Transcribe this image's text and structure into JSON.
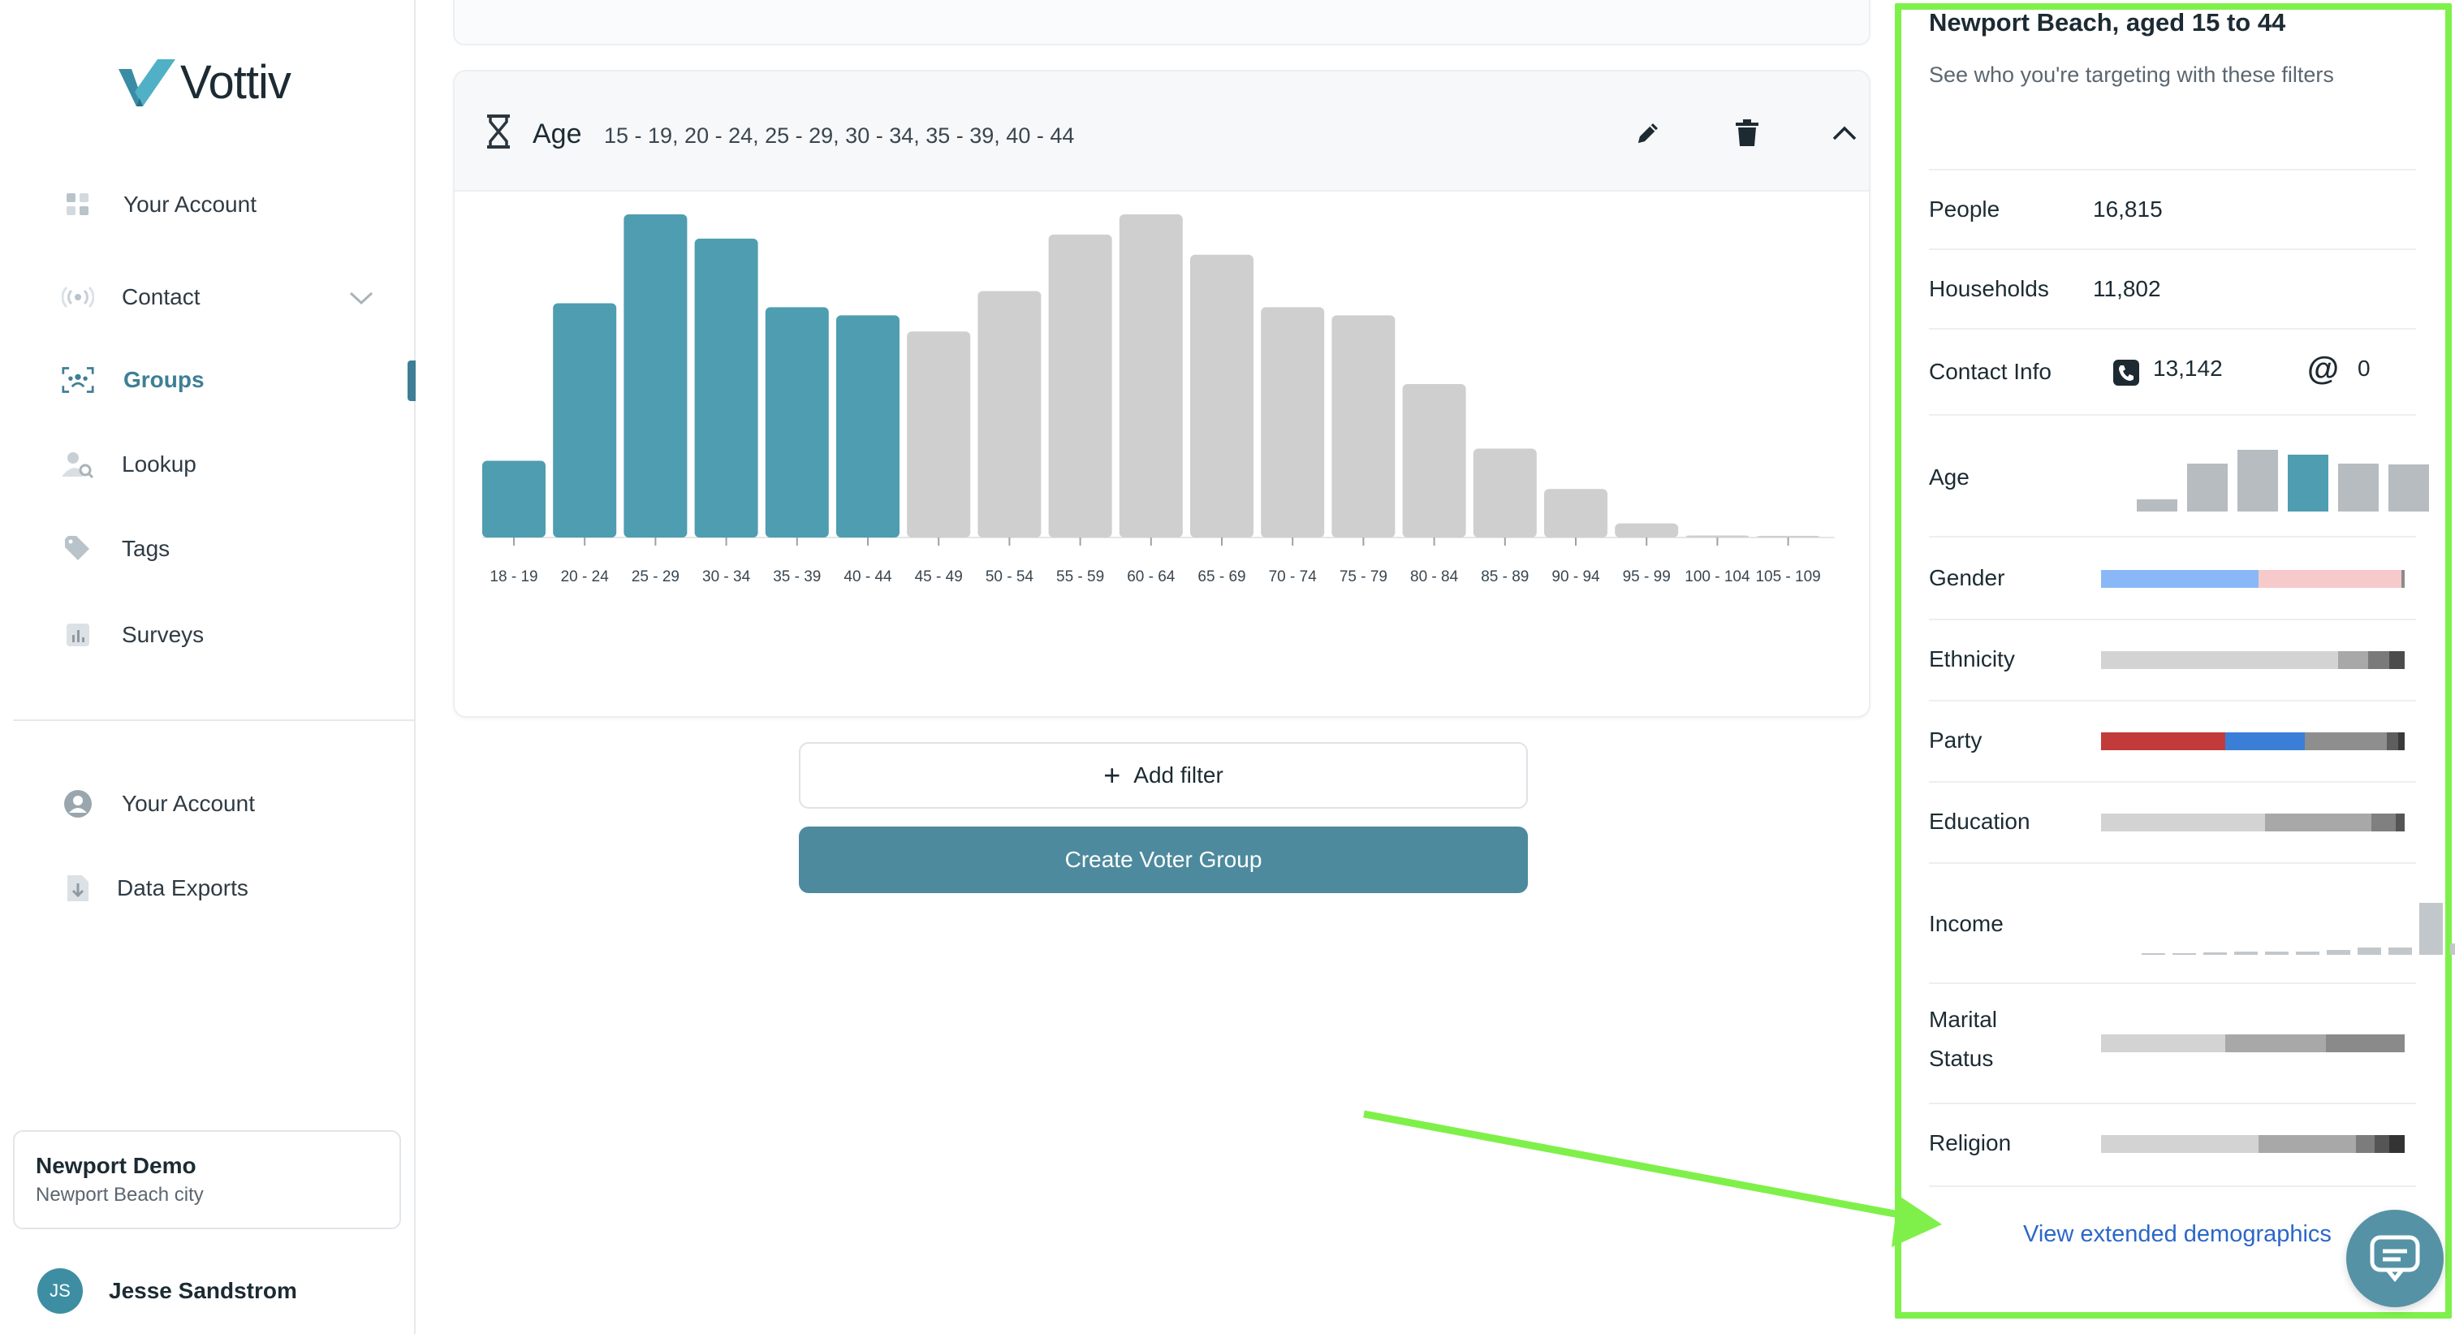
{
  "app": {
    "brand": "Vottiv"
  },
  "sidebar": {
    "items": [
      {
        "key": "account-top",
        "label": "Your Account",
        "icon": "grid-icon"
      },
      {
        "key": "contact",
        "label": "Contact",
        "icon": "broadcast-icon"
      },
      {
        "key": "groups",
        "label": "Groups",
        "icon": "group-icon",
        "active": true
      },
      {
        "key": "lookup",
        "label": "Lookup",
        "icon": "person-search-icon"
      },
      {
        "key": "tags",
        "label": "Tags",
        "icon": "tag-icon"
      },
      {
        "key": "surveys",
        "label": "Surveys",
        "icon": "bar-chart-icon"
      },
      {
        "key": "account-bottom",
        "label": "Your Account",
        "icon": "user-circle-icon"
      },
      {
        "key": "exports",
        "label": "Data Exports",
        "icon": "file-download-icon"
      }
    ],
    "org": {
      "name": "Newport Demo",
      "subtitle": "Newport Beach city"
    },
    "user": {
      "initials": "JS",
      "name": "Jesse Sandstrom"
    }
  },
  "filter": {
    "title": "Age",
    "values": "15 - 19, 20 - 24, 25 - 29, 30 - 34, 35 - 39, 40 - 44"
  },
  "chart_data": {
    "type": "bar",
    "categories": [
      "18 - 19",
      "20 - 24",
      "25 - 29",
      "30 - 34",
      "35 - 39",
      "40 - 44",
      "45 - 49",
      "50 - 54",
      "55 - 59",
      "60 - 64",
      "65 - 69",
      "70 - 74",
      "75 - 79",
      "80 - 84",
      "85 - 89",
      "90 - 94",
      "95 - 99",
      "100 - 104",
      "105 - 109"
    ],
    "values": [
      19,
      58,
      80,
      74,
      57,
      55,
      51,
      61,
      75,
      80,
      70,
      57,
      55,
      38,
      22,
      12,
      3.5,
      0.5,
      0.2
    ],
    "selected": [
      true,
      true,
      true,
      true,
      true,
      true,
      false,
      false,
      false,
      false,
      false,
      false,
      false,
      false,
      false,
      false,
      false,
      false,
      false
    ],
    "ylim": [
      0,
      80
    ],
    "colors": {
      "selected": "#4f9db0",
      "unselected": "#cfcfcf"
    }
  },
  "actions": {
    "add_filter": "Add filter",
    "create_group": "Create Voter Group"
  },
  "panel": {
    "title": "Newport Beach, aged 15 to 44",
    "subtitle": "See who you're targeting with these filters",
    "people_label": "People",
    "people_value": "16,815",
    "households_label": "Households",
    "households_value": "11,802",
    "contact_label": "Contact Info",
    "phone_count": "13,142",
    "email_count": "0",
    "age_label": "Age",
    "age_bars": [
      0.2,
      0.78,
      1.0,
      0.92,
      0.78,
      0.76
    ],
    "age_highlight": 3,
    "gender_label": "Gender",
    "gender_segments": [
      {
        "share": 52,
        "color": "#8ab8f7"
      },
      {
        "share": 47,
        "color": "#f6c9cb"
      },
      {
        "share": 1,
        "color": "#8c8c8c"
      }
    ],
    "ethnicity_label": "Ethnicity",
    "ethnicity_segments": [
      {
        "share": 78,
        "color": "#d3d3d3"
      },
      {
        "share": 10,
        "color": "#a8a8a8"
      },
      {
        "share": 7,
        "color": "#7a7a7a"
      },
      {
        "share": 5,
        "color": "#4c4c4c"
      }
    ],
    "party_label": "Party",
    "party_segments": [
      {
        "share": 41,
        "color": "#c23b3b"
      },
      {
        "share": 26,
        "color": "#3b7ed7"
      },
      {
        "share": 27,
        "color": "#8e8e8e"
      },
      {
        "share": 4,
        "color": "#5e5e5e"
      },
      {
        "share": 2,
        "color": "#3a3a3a"
      }
    ],
    "education_label": "Education",
    "education_segments": [
      {
        "share": 54,
        "color": "#d3d3d3"
      },
      {
        "share": 35,
        "color": "#a8a8a8"
      },
      {
        "share": 8,
        "color": "#808080"
      },
      {
        "share": 3,
        "color": "#555555"
      }
    ],
    "income_label": "Income",
    "income_bars": [
      0.03,
      0.03,
      0.05,
      0.06,
      0.06,
      0.06,
      0.1,
      0.14,
      0.14,
      1.0,
      0.22
    ],
    "marital_label_1": "Marital",
    "marital_label_2": "Status",
    "marital_segments": [
      {
        "share": 41,
        "color": "#d3d3d3"
      },
      {
        "share": 33,
        "color": "#a8a8a8"
      },
      {
        "share": 26,
        "color": "#8a8a8a"
      }
    ],
    "religion_label": "Religion",
    "religion_segments": [
      {
        "share": 52,
        "color": "#d3d3d3"
      },
      {
        "share": 32,
        "color": "#a8a8a8"
      },
      {
        "share": 6,
        "color": "#7c7c7c"
      },
      {
        "share": 5,
        "color": "#555555"
      },
      {
        "share": 5,
        "color": "#333333"
      }
    ],
    "extended_link": "View extended demographics"
  }
}
